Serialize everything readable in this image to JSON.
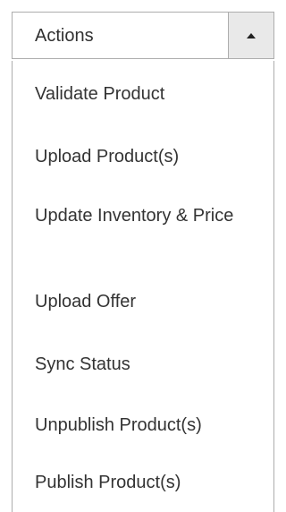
{
  "dropdown": {
    "label": "Actions",
    "arrow_icon": "caret-up-icon",
    "items": [
      {
        "label": "Validate Product"
      },
      {
        "label": "Upload Product(s)"
      },
      {
        "label": "Update Inventory & Price"
      },
      {
        "label": "Upload Offer"
      },
      {
        "label": "Sync Status"
      },
      {
        "label": "Unpublish Product(s)"
      },
      {
        "label": "Publish Product(s)"
      }
    ]
  },
  "colors": {
    "border": "#adadad",
    "arrow_box_bg": "#e9e9e9",
    "text": "#333333",
    "background": "#ffffff"
  }
}
